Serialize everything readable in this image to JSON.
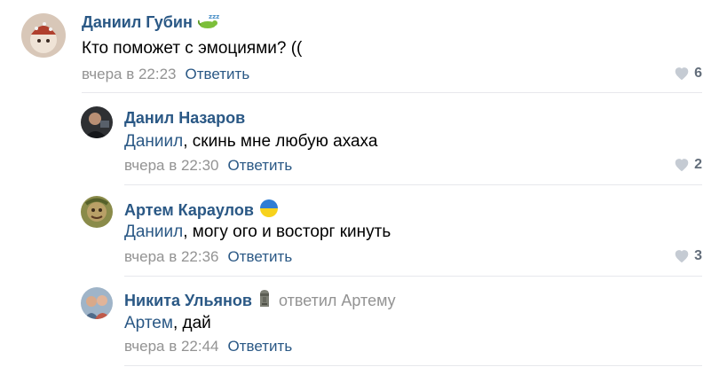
{
  "comments": [
    {
      "author": "Даниил Губин",
      "mention": "",
      "text": "Кто поможет с эмоциями? ((",
      "date": "вчера в 22:23",
      "reply_label": "Ответить",
      "likes": "6",
      "status_icon": "sleeping-lizard-icon"
    },
    {
      "author": "Данил Назаров",
      "mention": "Даниил",
      "text": ", скинь мне любую ахаха",
      "date": "вчера в 22:30",
      "reply_label": "Ответить",
      "likes": "2"
    },
    {
      "author": "Артем Караулов",
      "mention": "Даниил",
      "text": ", могу ого и восторг кинуть",
      "date": "вчера в 22:36",
      "reply_label": "Ответить",
      "likes": "3",
      "status_icon": "ukraine-flag-icon"
    },
    {
      "author": "Никита Ульянов",
      "replied_to": "ответил Артему",
      "mention": "Артем",
      "text": ", дай",
      "date": "вчера в 22:44",
      "reply_label": "Ответить",
      "status_icon": "moai-icon"
    }
  ],
  "colors": {
    "link": "#2a5885",
    "meta": "#939393",
    "like": "#626d7a",
    "divider": "#e7e8ec"
  }
}
